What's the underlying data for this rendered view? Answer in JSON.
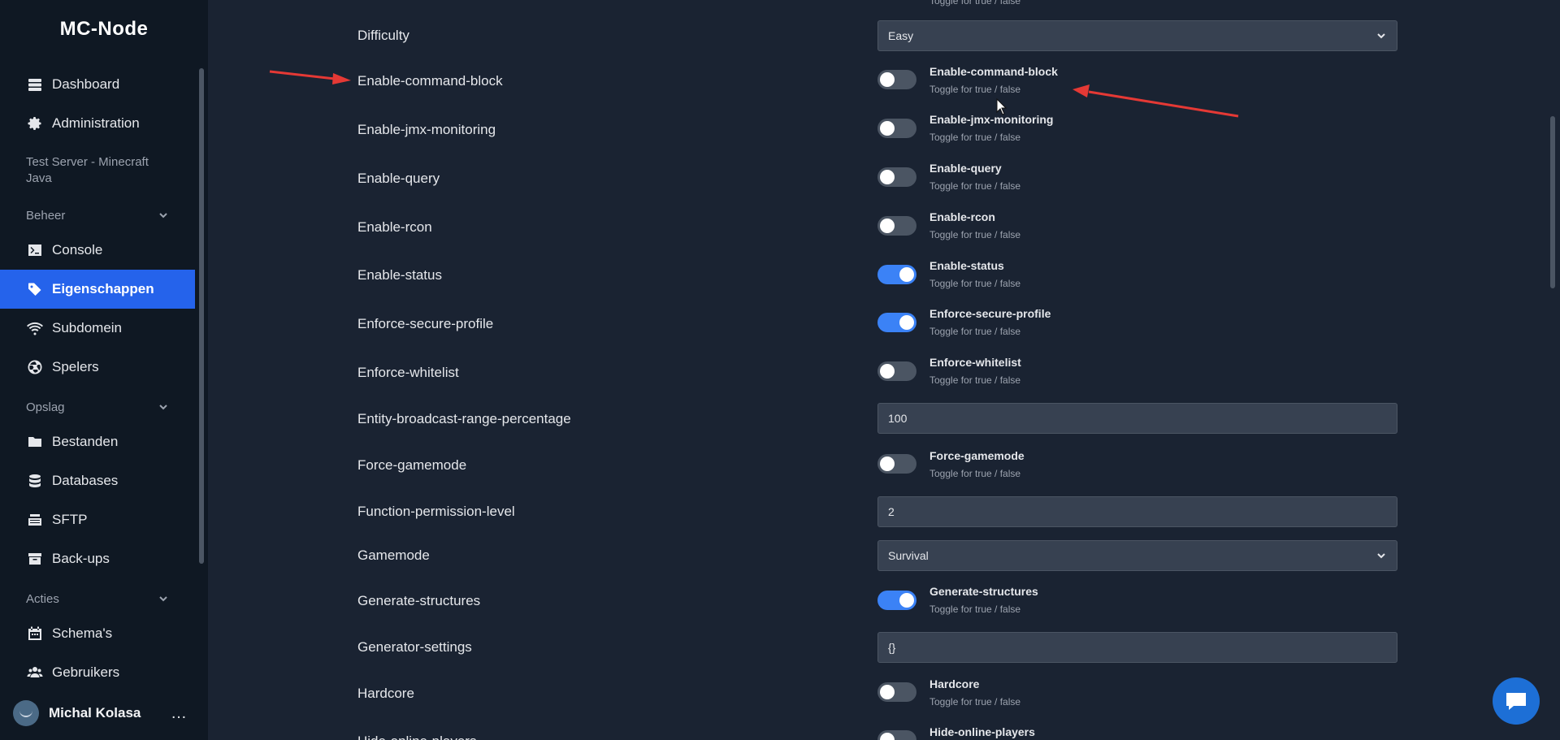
{
  "brand": "MC-Node",
  "sidebar": {
    "dashboard": "Dashboard",
    "administration": "Administration",
    "server_name": "Test Server - Minecraft Java",
    "section_beheer": "Beheer",
    "console": "Console",
    "eigenschappen": "Eigenschappen",
    "subdomein": "Subdomein",
    "spelers": "Spelers",
    "section_opslag": "Opslag",
    "bestanden": "Bestanden",
    "databases": "Databases",
    "sftp": "SFTP",
    "backups": "Back-ups",
    "section_acties": "Acties",
    "schemas": "Schema's",
    "gebruikers": "Gebruikers",
    "user_name": "Michal Kolasa",
    "more": "…"
  },
  "top_hint": "Toggle for true / false",
  "toggle_desc": "Toggle for true / false",
  "rows": {
    "difficulty": {
      "label": "Difficulty",
      "value": "Easy"
    },
    "enable_command_block": {
      "label": "Enable-command-block",
      "title": "Enable-command-block",
      "on": false
    },
    "enable_jmx_monitoring": {
      "label": "Enable-jmx-monitoring",
      "title": "Enable-jmx-monitoring",
      "on": false
    },
    "enable_query": {
      "label": "Enable-query",
      "title": "Enable-query",
      "on": false
    },
    "enable_rcon": {
      "label": "Enable-rcon",
      "title": "Enable-rcon",
      "on": false
    },
    "enable_status": {
      "label": "Enable-status",
      "title": "Enable-status",
      "on": true
    },
    "enforce_secure_profile": {
      "label": "Enforce-secure-profile",
      "title": "Enforce-secure-profile",
      "on": true
    },
    "enforce_whitelist": {
      "label": "Enforce-whitelist",
      "title": "Enforce-whitelist",
      "on": false
    },
    "entity_broadcast_range_percentage": {
      "label": "Entity-broadcast-range-percentage",
      "value": "100"
    },
    "force_gamemode": {
      "label": "Force-gamemode",
      "title": "Force-gamemode",
      "on": false
    },
    "function_permission_level": {
      "label": "Function-permission-level",
      "value": "2"
    },
    "gamemode": {
      "label": "Gamemode",
      "value": "Survival"
    },
    "generate_structures": {
      "label": "Generate-structures",
      "title": "Generate-structures",
      "on": true
    },
    "generator_settings": {
      "label": "Generator-settings",
      "value": "{}"
    },
    "hardcore": {
      "label": "Hardcore",
      "title": "Hardcore",
      "on": false
    },
    "hide_online_players": {
      "label": "Hide-online-players",
      "title": "Hide-online-players",
      "on": false
    }
  },
  "colors": {
    "accent": "#2563eb",
    "toggle_on": "#3b82f6",
    "toggle_off": "#4b5563",
    "background": "#1a2332",
    "sidebar": "#0f1823",
    "annotation_arrow": "#e53935"
  }
}
